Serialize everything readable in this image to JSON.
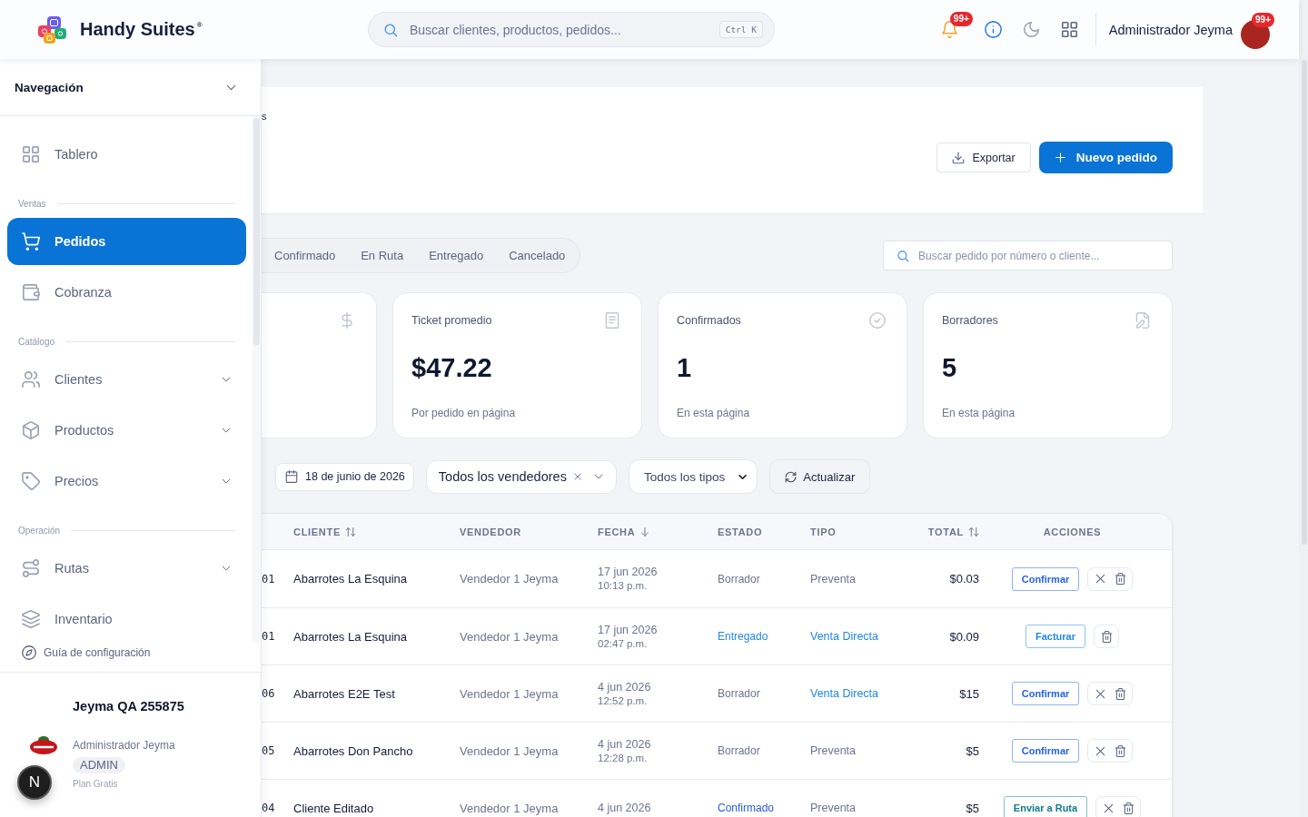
{
  "header": {
    "brand": "Handy Suites$^{®}$",
    "search": {
      "placeholder": "Buscar clientes, productos, pedidos...",
      "shortcut": "Ctrl K"
    },
    "notifications": {
      "count": "99+"
    },
    "user": {
      "name": "Administrador Jeyma",
      "count": "99+"
    }
  },
  "sidebar": {
    "title": "Navegación",
    "sections": [
      {
        "items": [
          {
            "label": "Tablero",
            "kind": "dashboard",
            "selected": false
          }
        ]
      },
      {
        "label": "Ventas",
        "items": [
          {
            "label": "Pedidos",
            "kind": "orders",
            "selected": true
          },
          {
            "label": "Cobranza",
            "kind": "billing",
            "selected": false
          }
        ]
      },
      {
        "label": "Catálogo",
        "items": [
          {
            "label": "Clientes",
            "kind": "clients",
            "selected": false,
            "expanded": false
          },
          {
            "label": "Productos",
            "kind": "products",
            "selected": false,
            "expanded": false
          },
          {
            "label": "Precios",
            "kind": "prices",
            "selected": false,
            "expanded": false
          }
        ]
      },
      {
        "label": "Operación",
        "items": [
          {
            "label": "Rutas",
            "kind": "routes",
            "selected": false,
            "expanded": false
          },
          {
            "label": "Inventario",
            "kind": "inventory",
            "selected": false
          }
        ]
      }
    ],
    "guide": "Guía de configuración",
    "account": {
      "company": "Jeyma QA 255875",
      "user": "Administrador Jeyma",
      "role": "ADMIN",
      "plan": "Plan Gratis"
    }
  },
  "dev_tools": {
    "label": "N"
  },
  "page_header": {
    "breadcrumb": "s",
    "actions": [
      {
        "kind": "export",
        "label": "Exportar"
      },
      {
        "kind": "create",
        "label": "Nuevo pedido"
      }
    ]
  },
  "status_tabs": [
    {
      "label": "Confirmado",
      "selected": false
    },
    {
      "label": "En Ruta",
      "selected": false
    },
    {
      "label": "Entregado",
      "selected": false
    },
    {
      "label": "Cancelado",
      "selected": false
    }
  ],
  "order_search": {
    "placeholder": "Buscar pedido por número o cliente..."
  },
  "stats": [
    {
      "kind": "total"
    },
    {
      "kind": "average",
      "title": "Ticket promedio",
      "value": "$47.22",
      "note": "Por pedido en página"
    },
    {
      "kind": "confirmed",
      "title": "Confirmados",
      "value": "1",
      "note": "En esta página"
    },
    {
      "kind": "drafts",
      "title": "Borradores",
      "value": "5",
      "note": "En esta página"
    }
  ],
  "filters": {
    "date": "18 de junio de 2026",
    "seller": "Todos los vendedores",
    "type": "Todos los tipos",
    "refresh": "Actualizar"
  },
  "table": {
    "columns": [
      {
        "label": "CLIENTE",
        "kind": "sortable"
      },
      {
        "label": "VENDEDOR",
        "kind": "plain"
      },
      {
        "label": "FECHA",
        "kind": "descending"
      },
      {
        "label": "ESTADO",
        "kind": "plain"
      },
      {
        "label": "TIPO",
        "kind": "plain"
      },
      {
        "label": "TOTAL",
        "kind": "sortable"
      },
      {
        "label": "ACCIONES",
        "kind": "plain"
      }
    ],
    "rows": [
      {
        "number": "01",
        "client": "Abarrotes La Esquina",
        "seller": "Vendedor 1 Jeyma",
        "date": "17 jun 2026",
        "time": "10:13 p.m.",
        "status": {
          "label": "Borrador",
          "color": "#6b7590"
        },
        "type": {
          "label": "Preventa",
          "color": "#6b7590"
        },
        "total": "$0.03",
        "action": {
          "label": "Confirmar",
          "color": "#2563eb"
        },
        "cancelable": true
      },
      {
        "number": "01",
        "client": "Abarrotes La Esquina",
        "seller": "Vendedor 1 Jeyma",
        "date": "17 jun 2026",
        "time": "02:47 p.m.",
        "status": {
          "label": "Entregado",
          "color": "#1e88e5"
        },
        "type": {
          "label": "Venta Directa",
          "color": "#1e88e5"
        },
        "total": "$0.09",
        "action": {
          "label": "Facturar",
          "color": "#1e88e5"
        },
        "cancelable": false
      },
      {
        "number": "06",
        "client": "Abarrotes E2E Test",
        "seller": "Vendedor 1 Jeyma",
        "date": "4 jun 2026",
        "time": "12:52 p.m.",
        "status": {
          "label": "Borrador",
          "color": "#6b7590"
        },
        "type": {
          "label": "Venta Directa",
          "color": "#1e88e5"
        },
        "total": "$15",
        "action": {
          "label": "Confirmar",
          "color": "#2563eb"
        },
        "cancelable": true
      },
      {
        "number": "05",
        "client": "Abarrotes Don Pancho",
        "seller": "Vendedor 1 Jeyma",
        "date": "4 jun 2026",
        "time": "12:28 p.m.",
        "status": {
          "label": "Borrador",
          "color": "#6b7590"
        },
        "type": {
          "label": "Preventa",
          "color": "#6b7590"
        },
        "total": "$5",
        "action": {
          "label": "Confirmar",
          "color": "#2563eb"
        },
        "cancelable": true
      },
      {
        "number": "04",
        "client": "Cliente Editado",
        "seller": "Vendedor 1 Jeyma",
        "date": "4 jun 2026",
        "status": {
          "label": "Confirmado",
          "color": "#2b5be0"
        },
        "type": {
          "label": "Preventa",
          "color": "#6b7590"
        },
        "total": "$5",
        "action": {
          "label": "Enviar a Ruta",
          "color": "#0e7c8a"
        },
        "cancelable": true
      }
    ]
  }
}
